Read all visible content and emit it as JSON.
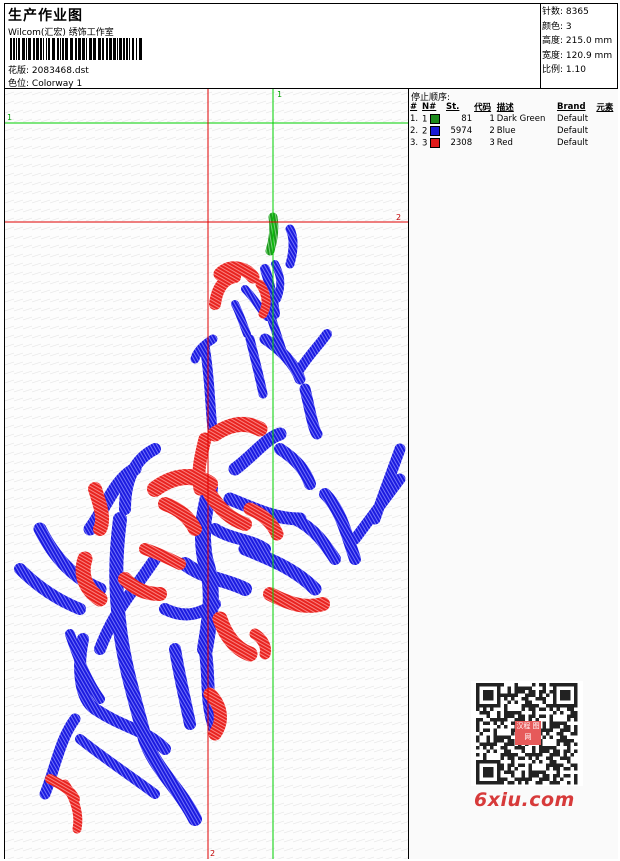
{
  "header": {
    "title": "生产作业图",
    "company": "Wilcom(汇宏) 绣饰工作室",
    "design_label": "花版:",
    "design_value": "2083468.dst",
    "colorway_label": "色位:",
    "colorway_value": "Colorway 1"
  },
  "stats": [
    {
      "label": "针数:",
      "value": "8365"
    },
    {
      "label": "颜色:",
      "value": "3"
    },
    {
      "label": "高度:",
      "value": "215.0 mm"
    },
    {
      "label": "宽度:",
      "value": "120.9 mm"
    },
    {
      "label": "比例:",
      "value": "1.10"
    }
  ],
  "stops": {
    "title": "停止顺序:",
    "columns": [
      "#",
      "N#",
      "St.",
      "代码",
      "描述",
      "Brand",
      "元素"
    ],
    "rows": [
      {
        "num": "1.",
        "n": "1",
        "color": "#1c8a1c",
        "st": "81",
        "code": "1",
        "desc": "Dark Green",
        "brand": "Default",
        "element": ""
      },
      {
        "num": "2.",
        "n": "2",
        "color": "#1b1bd6",
        "st": "5974",
        "code": "2",
        "desc": "Blue",
        "brand": "Default",
        "element": ""
      },
      {
        "num": "3.",
        "n": "3",
        "color": "#e01b1b",
        "st": "2308",
        "code": "3",
        "desc": "Red",
        "brand": "Default",
        "element": ""
      }
    ]
  },
  "guides": {
    "green_v": "1",
    "green_h": "1",
    "red_h": "2",
    "red_v": "2",
    "green_color": "#00d000",
    "red_color": "#e00000"
  },
  "watermark": "6xiu.com",
  "qr_logo": "汉程 图网"
}
